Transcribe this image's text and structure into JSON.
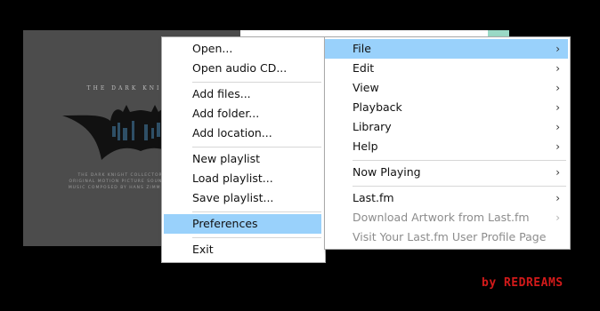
{
  "album": {
    "title_line": "THE DARK KNIGHT",
    "subtitle_lines": [
      "THE DARK KNIGHT COLLECTORS EDITION",
      "ORIGINAL MOTION PICTURE SOUNDTRACK & BO",
      "MUSIC COMPOSED BY HANS ZIMMER AND JAMES"
    ]
  },
  "file_menu": {
    "items": [
      {
        "label": "Open..."
      },
      {
        "label": "Open audio CD..."
      },
      {
        "label": "Add files..."
      },
      {
        "label": "Add folder..."
      },
      {
        "label": "Add location..."
      },
      {
        "label": "New playlist"
      },
      {
        "label": "Load playlist..."
      },
      {
        "label": "Save playlist..."
      },
      {
        "label": "Preferences",
        "highlighted": true
      },
      {
        "label": "Exit"
      }
    ]
  },
  "main_menu": {
    "items": [
      {
        "label": "File",
        "highlighted": true,
        "submenu": true
      },
      {
        "label": "Edit",
        "submenu": true
      },
      {
        "label": "View",
        "submenu": true
      },
      {
        "label": "Playback",
        "submenu": true
      },
      {
        "label": "Library",
        "submenu": true
      },
      {
        "label": "Help",
        "submenu": true
      },
      {
        "label": "Now Playing",
        "submenu": true
      },
      {
        "label": "Last.fm",
        "submenu": true
      },
      {
        "label": "Download Artwork from Last.fm",
        "disabled": true,
        "submenu": true
      },
      {
        "label": "Visit Your Last.fm User Profile Page",
        "disabled": true
      }
    ],
    "submenu_glyph": "›"
  },
  "watermark": {
    "text": "by REDREAMS"
  },
  "colors": {
    "highlight": "#99d1fb",
    "brand": "#d21a1a",
    "disabled_text": "#8c8c8c"
  }
}
